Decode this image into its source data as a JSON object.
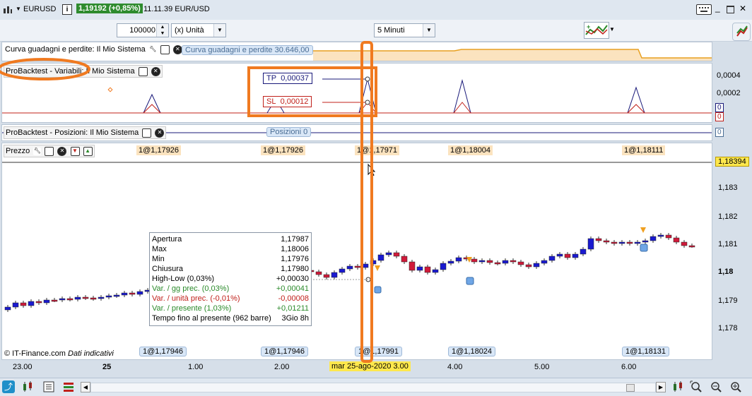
{
  "titlebar": {
    "symbol": "EURUSD",
    "info_icon_label": "i",
    "price_change": "1,19192 (+0,85%)",
    "time_label": "11.11.39 EUR/USD"
  },
  "toolbar": {
    "quantity_value": "100000",
    "unit_select": "(x) Unità",
    "timeframe_select": "5 Minuti"
  },
  "equity_panel": {
    "label": "Curva guadagni e perdite: Il Mio Sistema",
    "value_tag": "Curva guadagni e perdite   30.646,00"
  },
  "variables_panel": {
    "label": "ProBacktest - Variabili: Il Mio Sistema",
    "tp_label": "TP",
    "tp_value": "0,00037",
    "sl_label": "SL",
    "sl_value": "0,00012",
    "axis_ticks": [
      "0,0004",
      "0,0002"
    ],
    "right_tags": [
      "0",
      "0"
    ]
  },
  "positions_panel": {
    "label": "ProBacktest - Posizioni: Il Mio Sistema",
    "tag": "Posizioni   0",
    "right_tag": "0"
  },
  "price_panel": {
    "label": "Prezzo",
    "top_tags": [
      "1@1,17926",
      "1@1,17926",
      "1@1,17971",
      "1@1,18004",
      "1@1,18111"
    ],
    "bottom_tags": [
      "1@1,17946",
      "1@1,17946",
      "1@1,17991",
      "1@1,18024",
      "1@1,18131"
    ],
    "current_price": "1,18394",
    "axis_ticks": [
      "1,183",
      "1,182",
      "1,181",
      "1,18",
      "1,179",
      "1,178"
    ],
    "copyright": "© IT-Finance.com",
    "note": "Dati indicativi"
  },
  "infobox": {
    "rows": [
      {
        "label": "Apertura",
        "value": "1,17987",
        "color": "#000000"
      },
      {
        "label": "Max",
        "value": "1,18006",
        "color": "#000000"
      },
      {
        "label": "Min",
        "value": "1,17976",
        "color": "#000000"
      },
      {
        "label": "Chiusura",
        "value": "1,17980",
        "color": "#000000"
      },
      {
        "label": "High-Low (0,03%)",
        "value": "+0,00030",
        "color": "#000000"
      },
      {
        "label": "Var. / gg prec. (0,03%)",
        "value": "+0,00041",
        "color": "#2a8a2a"
      },
      {
        "label": "Var. / unità prec. (-0,01%)",
        "value": "-0,00008",
        "color": "#c0201a"
      },
      {
        "label": "Var. / presente (1,03%)",
        "value": "+0,01211",
        "color": "#2a8a2a"
      },
      {
        "label": "Tempo fino al presente (962 barre)",
        "value": "3Gio 8h",
        "color": "#000000"
      }
    ]
  },
  "x_axis": {
    "labels": [
      "23.00",
      "25",
      "1.00",
      "2.00",
      "4.00",
      "5.00",
      "6.00"
    ],
    "cursor_label": "mar 25-ago-2020 3.00"
  },
  "colors": {
    "candle_up": "#1a1ad0",
    "candle_down": "#d01a3a",
    "highlight": "#f07a20",
    "equity_line": "#e8a020",
    "price_badge": "#2e8b2e"
  }
}
